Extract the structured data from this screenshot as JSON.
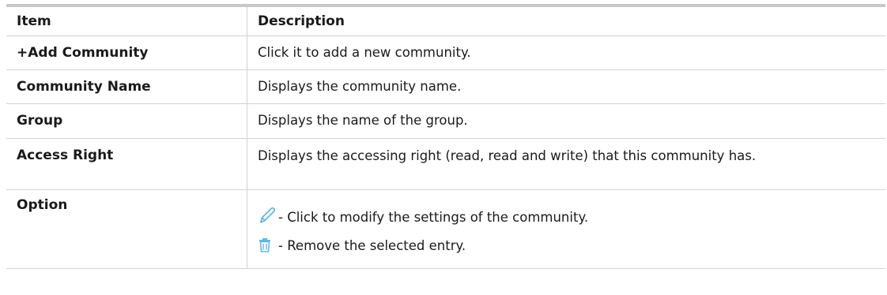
{
  "table": {
    "header": {
      "item": "Item",
      "description": "Description"
    },
    "rows": [
      {
        "item": "+Add Community",
        "description": "Click it to add a new community."
      },
      {
        "item": "Community Name",
        "description": "Displays the community name."
      },
      {
        "item": "Group",
        "description": "Displays the name of the group."
      },
      {
        "item": "Access Right",
        "description": "Displays the accessing right (read, read and write) that this community has."
      },
      {
        "item": "Option",
        "options": [
          {
            "icon": "pencil-icon",
            "text": "- Click to modify the settings of the community."
          },
          {
            "icon": "trash-icon",
            "text": "- Remove the selected entry."
          }
        ]
      }
    ]
  },
  "colors": {
    "icon": "#62b6f0",
    "border": "#d2d2d2",
    "top_rule": "#c8c8c8"
  }
}
